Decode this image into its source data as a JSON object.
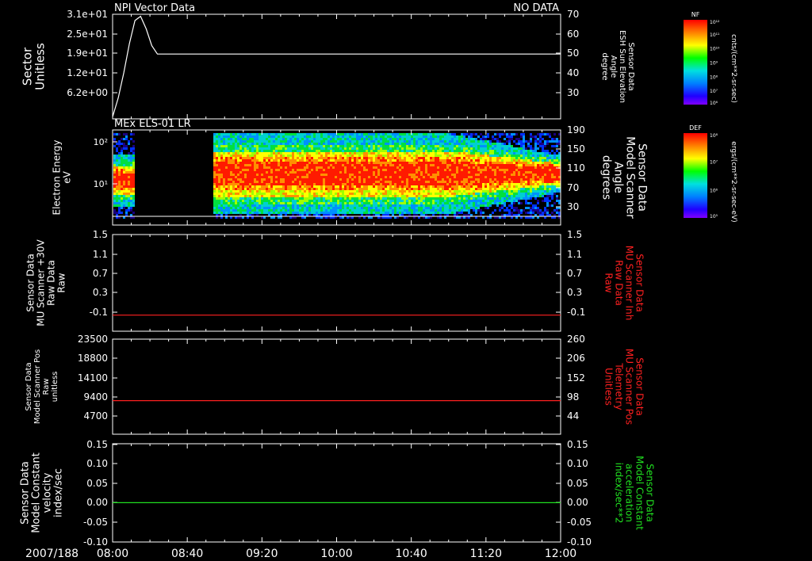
{
  "footer": {
    "date": "2007/188",
    "time_ticks": [
      "08:00",
      "08:40",
      "09:20",
      "10:00",
      "10:40",
      "11:20",
      "12:00"
    ]
  },
  "colorbars": [
    {
      "label": "NF",
      "top_tick": "10¹²",
      "ticks": [
        "10¹¹",
        "10¹⁰",
        "10⁹",
        "10⁸",
        "10⁷"
      ],
      "bottom_tick": "10⁶",
      "units": "cnts/(cm**2-sr-sec)"
    },
    {
      "label": "DEF",
      "top_tick": "10⁸",
      "ticks": [
        "10⁷",
        "10⁶"
      ],
      "bottom_tick": "10⁵",
      "units": "ergs/(cm**2-sr-sec-eV)"
    }
  ],
  "colors": {
    "background": "#000000",
    "axis": "#ffffff",
    "red_trace": "#ff2020",
    "green_trace": "#20e020"
  },
  "chart_data": [
    {
      "type": "line",
      "title": "NPI Vector Data",
      "status": "NO DATA",
      "left_ylabel": [
        "Sector",
        "Unitless"
      ],
      "left_ticks": [
        "3.1e+01",
        "2.5e+01",
        "1.9e+01",
        "1.2e+01",
        "6.2e+00"
      ],
      "right_ylabel": [
        "Sensor Data",
        "ESH Sun Elevation",
        "Angle",
        "degree"
      ],
      "right_ticks": [
        "70",
        "60",
        "50",
        "40",
        "30"
      ],
      "right_ylim": [
        20,
        70
      ],
      "x_range_hours": [
        8.0,
        12.0
      ],
      "series": [
        {
          "x": [
            8.0,
            8.05,
            8.1,
            8.15,
            8.2,
            8.25,
            8.3,
            8.35,
            8.4,
            8.5,
            12.0
          ],
          "y": [
            21,
            30,
            42,
            56,
            67,
            69,
            63,
            55,
            51,
            51,
            51
          ]
        }
      ]
    },
    {
      "type": "heatmap",
      "title": "MEx ELS-01 LR",
      "left_ylabel": [
        "Electron Energy",
        "eV"
      ],
      "left_ticks": [
        "10²",
        "10¹"
      ],
      "right_ylabel": [
        "Sensor Data",
        "Model Scanner",
        "Angle",
        "degrees"
      ],
      "right_ticks": [
        "190",
        "150",
        "110",
        "70",
        "30"
      ],
      "data_gap_hours": [
        8.18,
        8.88
      ],
      "reference_line_right_value": 12
    },
    {
      "type": "line",
      "left_ylabel": [
        "Sensor Data",
        "MU Scanner +30V",
        "Raw Data",
        "Raw"
      ],
      "left_ticks": [
        "1.5",
        "1.1",
        "0.7",
        "0.3",
        "-0.1"
      ],
      "right_ylabel": [
        "Sensor Data",
        "MU Scanner Inh",
        "Raw Data",
        "Raw"
      ],
      "right_ticks": [
        "1.5",
        "1.1",
        "0.7",
        "0.3",
        "-0.1"
      ],
      "ylim": [
        -0.3,
        1.5
      ],
      "series": [
        {
          "y_const": 0.0,
          "color": "red"
        }
      ]
    },
    {
      "type": "line",
      "left_ylabel": [
        "Sensor Data",
        "Model Scanner Pos",
        "Raw",
        "unitless"
      ],
      "left_ticks": [
        "23500",
        "18800",
        "14100",
        "9400",
        "4700"
      ],
      "right_ylabel": [
        "Sensor Data",
        "MU Scanner Pos",
        "Telemetry",
        "Unitless"
      ],
      "right_ticks": [
        "260",
        "206",
        "152",
        "98",
        "44"
      ],
      "ylim": [
        0,
        23500
      ],
      "series": [
        {
          "y_const": 8300,
          "color": "red"
        }
      ]
    },
    {
      "type": "line",
      "left_ylabel": [
        "Sensor Data",
        "Model Constant",
        "velocity",
        "index/sec"
      ],
      "left_ticks": [
        "0.15",
        "0.10",
        "0.05",
        "0.00",
        "-0.05",
        "-0.10"
      ],
      "right_ylabel": [
        "Sensor Data",
        "Model Constant",
        "acceleration",
        "index/sec**2"
      ],
      "right_ticks": [
        "0.15",
        "0.10",
        "0.05",
        "0.00",
        "-0.05",
        "-0.10"
      ],
      "ylim": [
        -0.1,
        0.15
      ],
      "series": [
        {
          "y_const": 0.0,
          "color": "green"
        }
      ]
    }
  ]
}
